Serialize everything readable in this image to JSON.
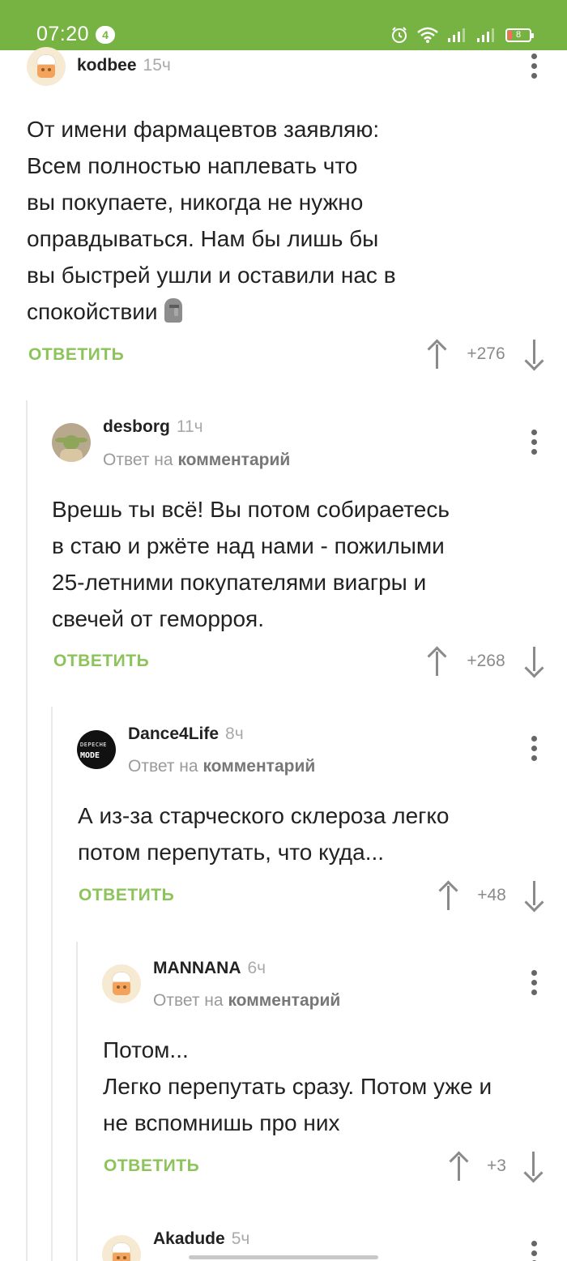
{
  "status_bar": {
    "time": "07:20",
    "notification_count": "4",
    "battery_level": "8",
    "icons": [
      "alarm-icon",
      "wifi-icon",
      "signal-icon",
      "signal-icon"
    ]
  },
  "colors": {
    "status_bar_bg": "#77b343",
    "reply_button": "#8cc35a",
    "thread_line": "#e9e9e9"
  },
  "reply_label": "ОТВЕТИТЬ",
  "reply_to_prefix": "Ответ на",
  "reply_to_link": "комментарий",
  "comments": [
    {
      "author": "kodbee",
      "time": "15ч",
      "text": "От имени фармацевтов заявляю:\nВсем полностью наплевать что\nвы покупаете, никогда не нужно\nоправдываться. Нам бы лишь бы\nвы быстрей ушли и оставили нас в\nспокойствии",
      "emoji": "moai-icon",
      "score": "+276"
    },
    {
      "author": "desborg",
      "time": "11ч",
      "text": "Врешь ты всё! Вы потом собираетесь\nв стаю и ржёте над нами - пожилыми\n25-летними покупателями виагры и\nсвечей от геморроя.",
      "score": "+268"
    },
    {
      "author": "Dance4Life",
      "time": "8ч",
      "avatar_text": [
        "DEPECHE",
        "MODE"
      ],
      "text": "А из-за старческого склероза легко\nпотом перепутать, что куда...",
      "score": "+48"
    },
    {
      "author": "MANNANA",
      "time": "6ч",
      "text": "Потом...\nЛегко перепутать сразу. Потом уже и\nне вспомнишь про них",
      "score": "+3"
    },
    {
      "author": "Akadude",
      "time": "5ч"
    }
  ]
}
